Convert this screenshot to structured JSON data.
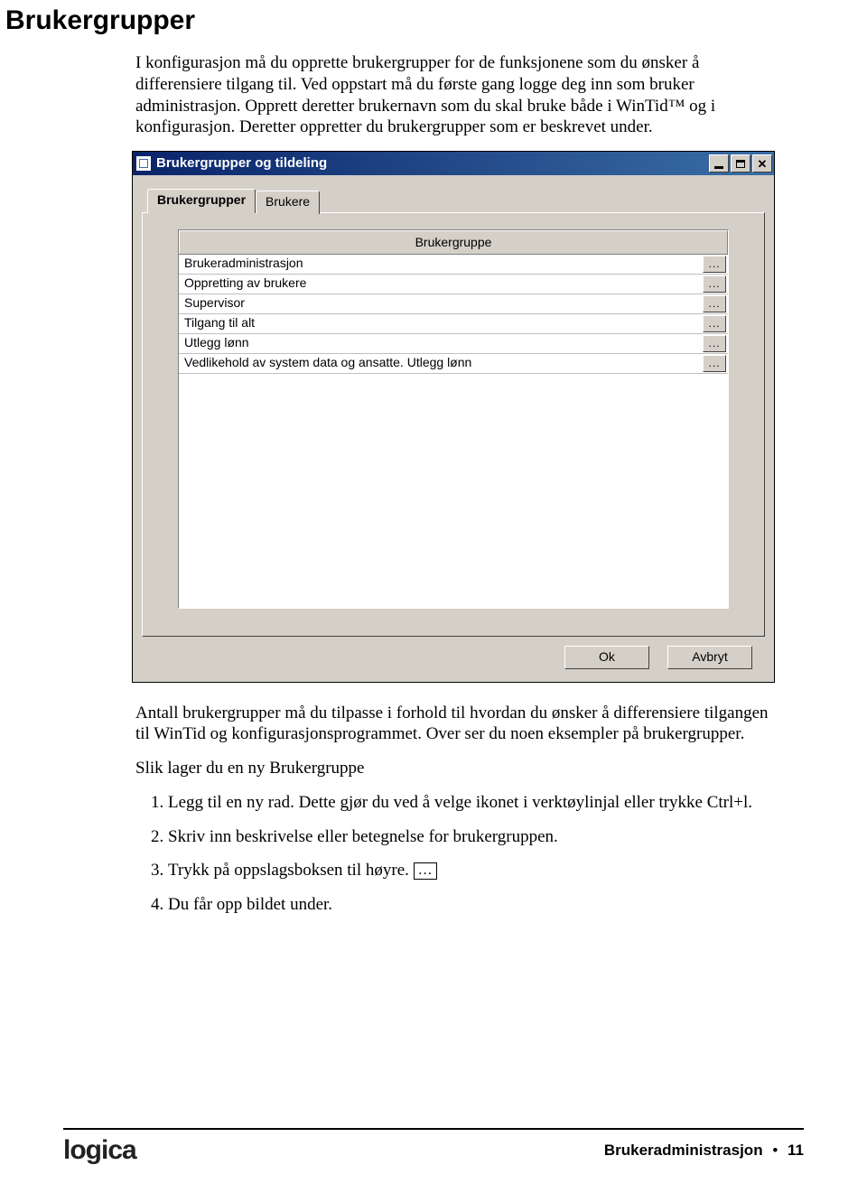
{
  "page_heading": "Brukergrupper",
  "intro": "I konfigurasjon må du opprette brukergrupper for de funksjonene som du ønsker å differensiere tilgang til. Ved oppstart må du første gang logge deg inn som bruker administrasjon. Opprett deretter brukernavn som du skal bruke både i WinTid™ og i konfigurasjon. Deretter oppretter du brukergrupper som er beskrevet under.",
  "dialog": {
    "title": "Brukergrupper og tildeling",
    "tabs": {
      "active": "Brukergrupper",
      "inactive": "Brukere"
    },
    "column_header": "Brukergruppe",
    "rows": [
      "Brukeradministrasjon",
      "Oppretting av brukere",
      "Supervisor",
      "Tilgang til alt",
      "Utlegg lønn",
      "Vedlikehold av system data og ansatte. Utlegg lønn"
    ],
    "row_button": "...",
    "ok": "Ok",
    "cancel": "Avbryt"
  },
  "after_para": "Antall brukergrupper må du tilpasse i forhold til hvordan du ønsker å differensiere tilgangen til WinTid og konfigurasjonsprogrammet. Over ser du noen eksempler på brukergrupper.",
  "subheading": "Slik lager du en ny Brukergruppe",
  "steps": {
    "s1": "Legg til en ny rad. Dette gjør du ved å velge ikonet i verktøylinjal eller trykke Ctrl+l.",
    "s2": "Skriv inn beskrivelse eller betegnelse for brukergruppen.",
    "s3_pre": "Trykk på oppslagsboksen til høyre. ",
    "s3_box": "…",
    "s4": "Du får opp bildet under."
  },
  "footer": {
    "logo": "logica",
    "section": "Brukeradministrasjon",
    "page": "11"
  }
}
